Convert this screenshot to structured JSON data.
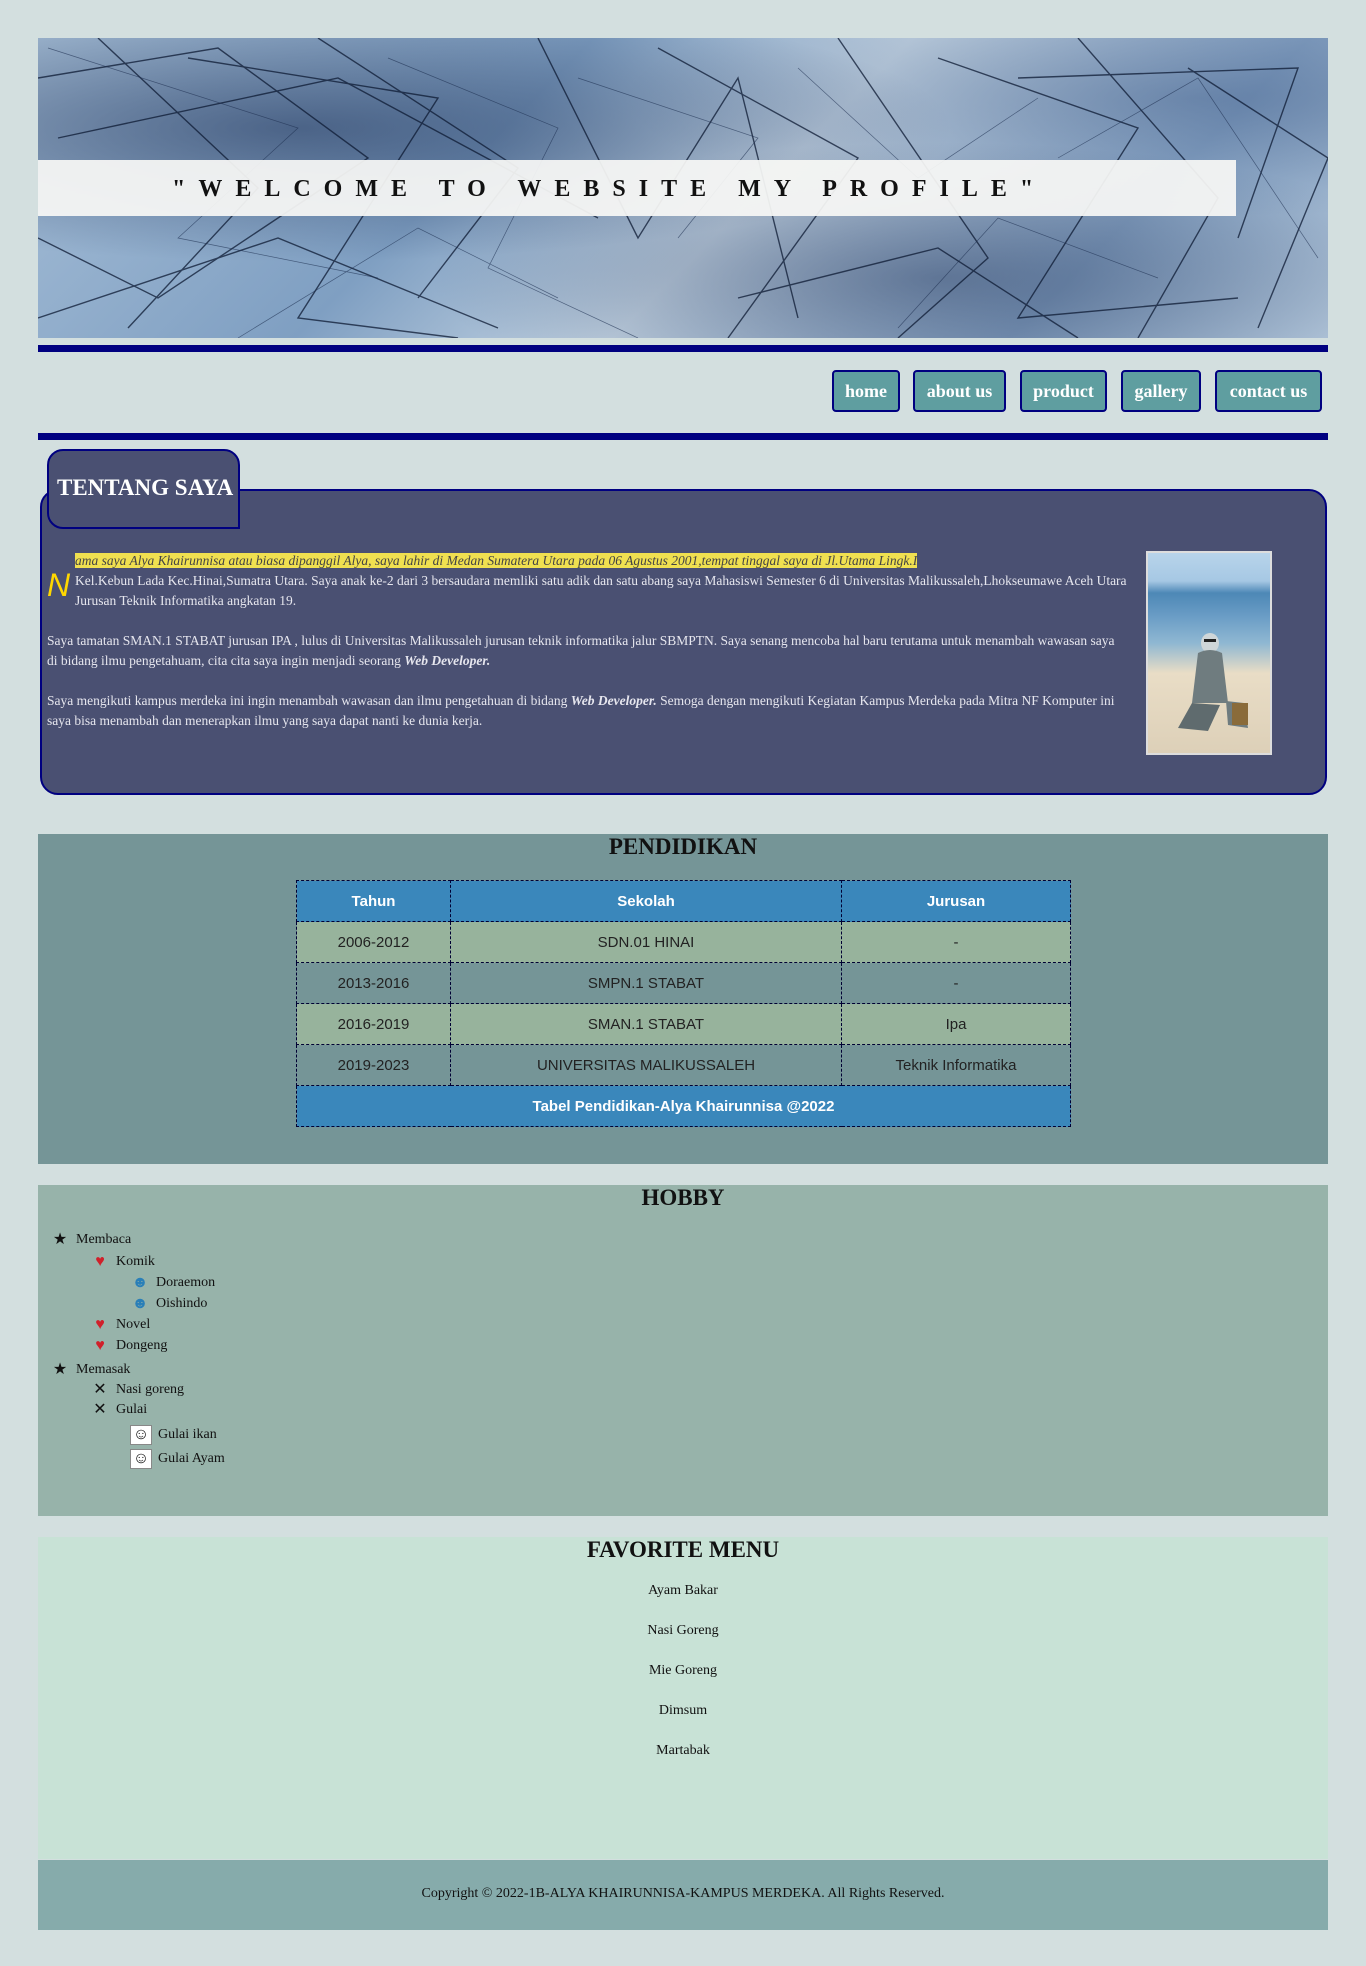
{
  "header": {
    "title": "\"WELCOME TO WEBSITE MY PROFILE\""
  },
  "nav": {
    "items": [
      {
        "label": "home"
      },
      {
        "label": "about us"
      },
      {
        "label": "product"
      },
      {
        "label": "gallery"
      },
      {
        "label": "contact us"
      }
    ]
  },
  "about": {
    "heading": "TENTANG SAYA",
    "dropcap": "N",
    "para1_highlight": "ama saya Alya Khairunnisa atau biasa dipanggil Alya, saya lahir di Medan Sumatera Utara pada 06 Agustus 2001,tempat tinggal saya di Jl.Utama Lingk.I",
    "para1_rest": "Kel.Kebun Lada Kec.Hinai,Sumatra Utara. Saya anak ke-2 dari 3 bersaudara memliki satu adik dan satu abang saya Mahasiswi Semester 6 di Universitas Malikussaleh,Lhokseumawe Aceh Utara Jurusan Teknik Informatika angkatan 19.",
    "para2_text": "Saya tamatan SMAN.1 STABAT jurusan IPA , lulus di Universitas Malikussaleh jurusan teknik informatika jalur SBMPTN. Saya senang mencoba hal baru terutama untuk menambah wawasan saya di bidang ilmu pengetahuam, cita cita saya ingin menjadi seorang ",
    "para2_bold": "Web Developer.",
    "para3_text1": "Saya mengikuti kampus merdeka ini ingin menambah wawasan dan ilmu pengetahuan di bidang ",
    "para3_bold": "Web Developer.",
    "para3_text2": " Semoga dengan mengikuti Kegiatan Kampus Merdeka pada Mitra NF Komputer ini saya bisa menambah dan menerapkan ilmu yang saya dapat nanti ke dunia kerja."
  },
  "pendidikan": {
    "title": "PENDIDIKAN",
    "headers": [
      "Tahun",
      "Sekolah",
      "Jurusan"
    ],
    "rows": [
      [
        "2006-2012",
        "SDN.01 HINAI",
        "-"
      ],
      [
        "2013-2016",
        "SMPN.1 STABAT",
        "-"
      ],
      [
        "2016-2019",
        "SMAN.1 STABAT",
        "Ipa"
      ],
      [
        "2019-2023",
        "UNIVERSITAS MALIKUSSALEH",
        "Teknik Informatika"
      ]
    ],
    "caption": "Tabel Pendidikan-Alya Khairunnisa @2022"
  },
  "hobby": {
    "title": "HOBBY",
    "items": [
      {
        "label": "Membaca",
        "icon": "star-icon"
      },
      {
        "label": "Komik",
        "icon": "heart-icon"
      },
      {
        "label": "Doraemon",
        "icon": "person-icon"
      },
      {
        "label": "Oishindo",
        "icon": "person-icon"
      },
      {
        "label": "Novel",
        "icon": "heart-icon"
      },
      {
        "label": "Dongeng",
        "icon": "heart-icon"
      },
      {
        "label": "Memasak",
        "icon": "star-icon"
      },
      {
        "label": "Nasi goreng",
        "icon": "crossed-utensils-icon"
      },
      {
        "label": "Gulai",
        "icon": "crossed-utensils-icon"
      },
      {
        "label": "Gulai ikan",
        "icon": "smiley-icon"
      },
      {
        "label": "Gulai Ayam",
        "icon": "smiley-icon"
      }
    ]
  },
  "favorite": {
    "title": "FAVORITE MENU",
    "items": [
      "Ayam Bakar",
      "Nasi Goreng",
      "Mie Goreng",
      "Dimsum",
      "Martabak"
    ]
  },
  "footer": {
    "text": "Copyright © 2022-1B-ALYA KHAIRUNNISA-KAMPUS MERDEKA. All Rights Reserved."
  },
  "colors": {
    "page_bg": "#d3dfdf",
    "rule": "#000080",
    "nav_button": "#5f9ea0",
    "about_bg": "#4a5072",
    "table_header": "#3a87bb",
    "highlight": "#f0e050"
  }
}
